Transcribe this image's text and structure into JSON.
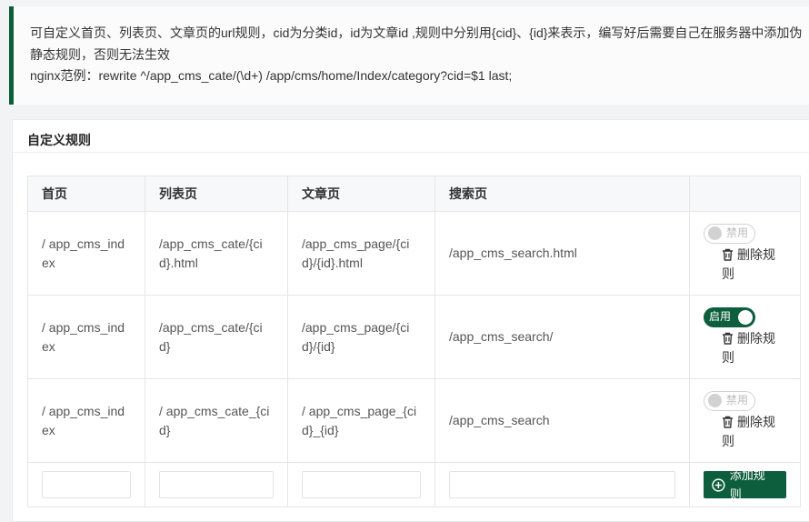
{
  "notice": {
    "line1": "可自定义首页、列表页、文章页的url规则，cid为分类id，id为文章id ,规则中分别用{cid}、{id}来表示，编写好后需要自己在服务器中添加伪静态规则，否则无法生效",
    "line2": "nginx范例：rewrite ^/app_cms_cate/(\\d+) /app/cms/home/Index/category?cid=$1 last;"
  },
  "card": {
    "title": "自定义规则"
  },
  "table": {
    "headers": [
      "首页",
      "列表页",
      "文章页",
      "搜索页",
      ""
    ],
    "rows": [
      {
        "index": "/ app_cms_index",
        "list": "/app_cms_cate/{cid}.html",
        "article": "/app_cms_page/{cid}/{id}.html",
        "search": "/app_cms_search.html",
        "enabled": false,
        "switch_label": "禁用",
        "delete_label": "删除规则"
      },
      {
        "index": "/ app_cms_index",
        "list": "/app_cms_cate/{cid}",
        "article": "/app_cms_page/{cid}/{id}",
        "search": "/app_cms_search/",
        "enabled": true,
        "switch_label": "启用",
        "delete_label": "删除规则"
      },
      {
        "index": "/ app_cms_index",
        "list": "/ app_cms_cate_{cid}",
        "article": "/ app_cms_page_{cid}_{id}",
        "search": "/app_cms_search",
        "enabled": false,
        "switch_label": "禁用",
        "delete_label": "删除规则"
      }
    ],
    "new_row": {
      "index": "",
      "list": "",
      "article": "",
      "search": "",
      "add_label": "添加规则"
    }
  },
  "colors": {
    "accent": "#0d5e3c"
  },
  "icons": {
    "delete": "trash-icon",
    "add": "plus-circle-icon"
  }
}
